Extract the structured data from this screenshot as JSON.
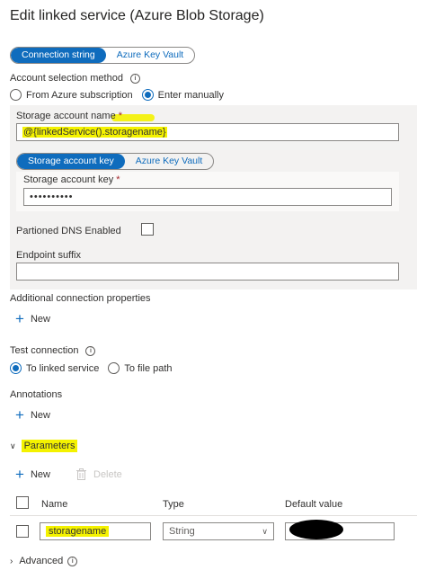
{
  "header": {
    "title": "Edit linked service (Azure Blob Storage)"
  },
  "auth_tabs": [
    {
      "label": "Connection string",
      "active": true
    },
    {
      "label": "Azure Key Vault",
      "active": false
    }
  ],
  "account_selection": {
    "label": "Account selection method",
    "options": [
      {
        "label": "From Azure subscription",
        "checked": false
      },
      {
        "label": "Enter manually",
        "checked": true
      }
    ]
  },
  "storage_account_name": {
    "label": "Storage account name",
    "required_mark": "*",
    "value": "@{linkedService().storagename}"
  },
  "key_tabs": [
    {
      "label": "Storage account key",
      "active": true
    },
    {
      "label": "Azure Key Vault",
      "active": false
    }
  ],
  "storage_account_key": {
    "label": "Storage account key",
    "required_mark": "*",
    "value": "••••••••••"
  },
  "partitioned_dns": {
    "label": "Partioned DNS Enabled"
  },
  "endpoint_suffix": {
    "label": "Endpoint suffix",
    "value": ""
  },
  "additional_props": {
    "label": "Additional connection properties",
    "new_label": "New"
  },
  "test_connection": {
    "label": "Test connection",
    "options": [
      {
        "label": "To linked service",
        "checked": true
      },
      {
        "label": "To file path",
        "checked": false
      }
    ]
  },
  "annotations": {
    "label": "Annotations",
    "new_label": "New"
  },
  "parameters": {
    "label": "Parameters",
    "new_label": "New",
    "delete_label": "Delete",
    "columns": [
      "Name",
      "Type",
      "Default value"
    ],
    "rows": [
      {
        "name": "storagename",
        "type": "String",
        "default": ""
      }
    ]
  },
  "advanced": {
    "label": "Advanced"
  },
  "colors": {
    "accent": "#0f6cbd",
    "highlight": "#f4f200"
  }
}
